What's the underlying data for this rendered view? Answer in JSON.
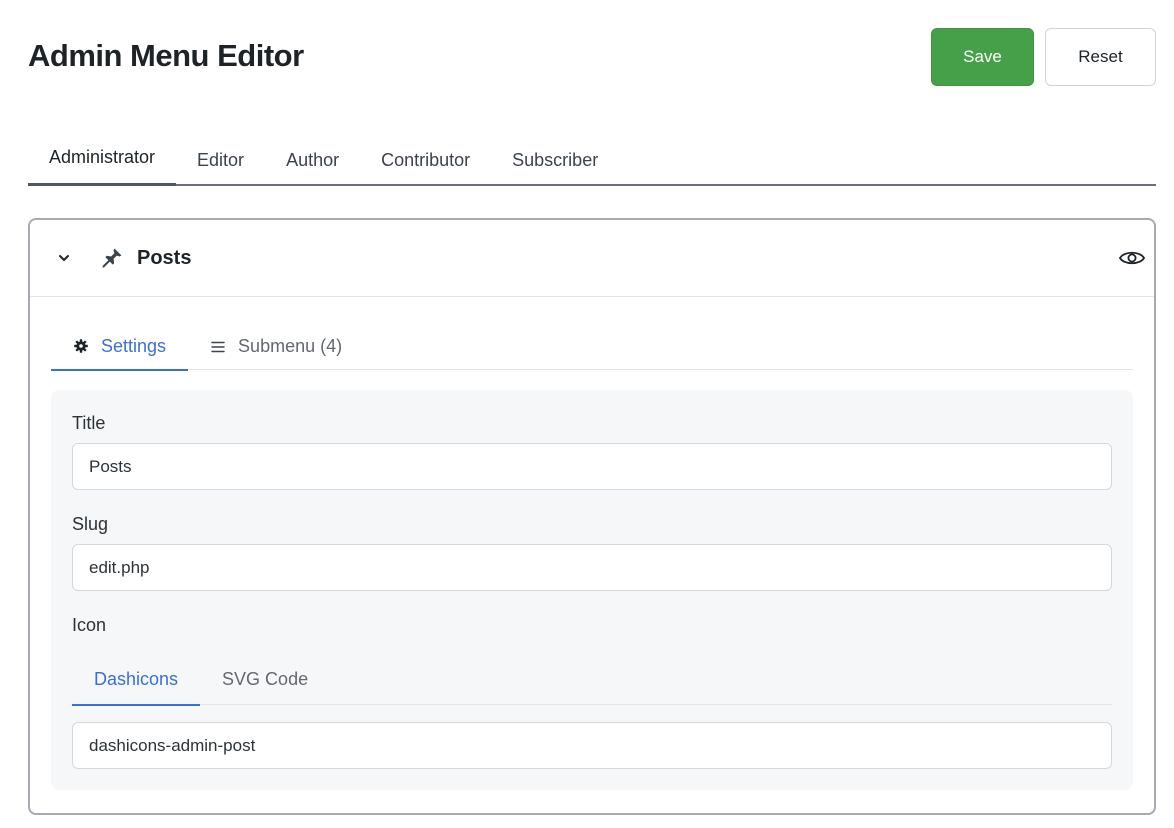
{
  "page": {
    "title": "Admin Menu Editor"
  },
  "toolbar": {
    "save_label": "Save",
    "reset_label": "Reset"
  },
  "roles": [
    "Administrator",
    "Editor",
    "Author",
    "Contributor",
    "Subscriber"
  ],
  "active_role": "Administrator",
  "menu_item": {
    "title": "Posts",
    "icons": {
      "collapse": "chevron-down-icon",
      "item": "pin-icon",
      "visibility": "eye-icon"
    },
    "tabs": [
      {
        "label": "Settings",
        "icon": "gear-icon"
      },
      {
        "label": "Submenu (4)",
        "icon": "list-icon"
      }
    ],
    "active_tab": "Settings",
    "fields": {
      "title_label": "Title",
      "title_value": "Posts",
      "slug_label": "Slug",
      "slug_value": "edit.php",
      "icon_label": "Icon"
    },
    "icon_tabs": [
      "Dashicons",
      "SVG Code"
    ],
    "active_icon_tab": "Dashicons",
    "icon_value": "dashicons-admin-post"
  },
  "colors": {
    "save": "#46a049",
    "accent": "#3a6fd8",
    "text": "#1d2327"
  }
}
